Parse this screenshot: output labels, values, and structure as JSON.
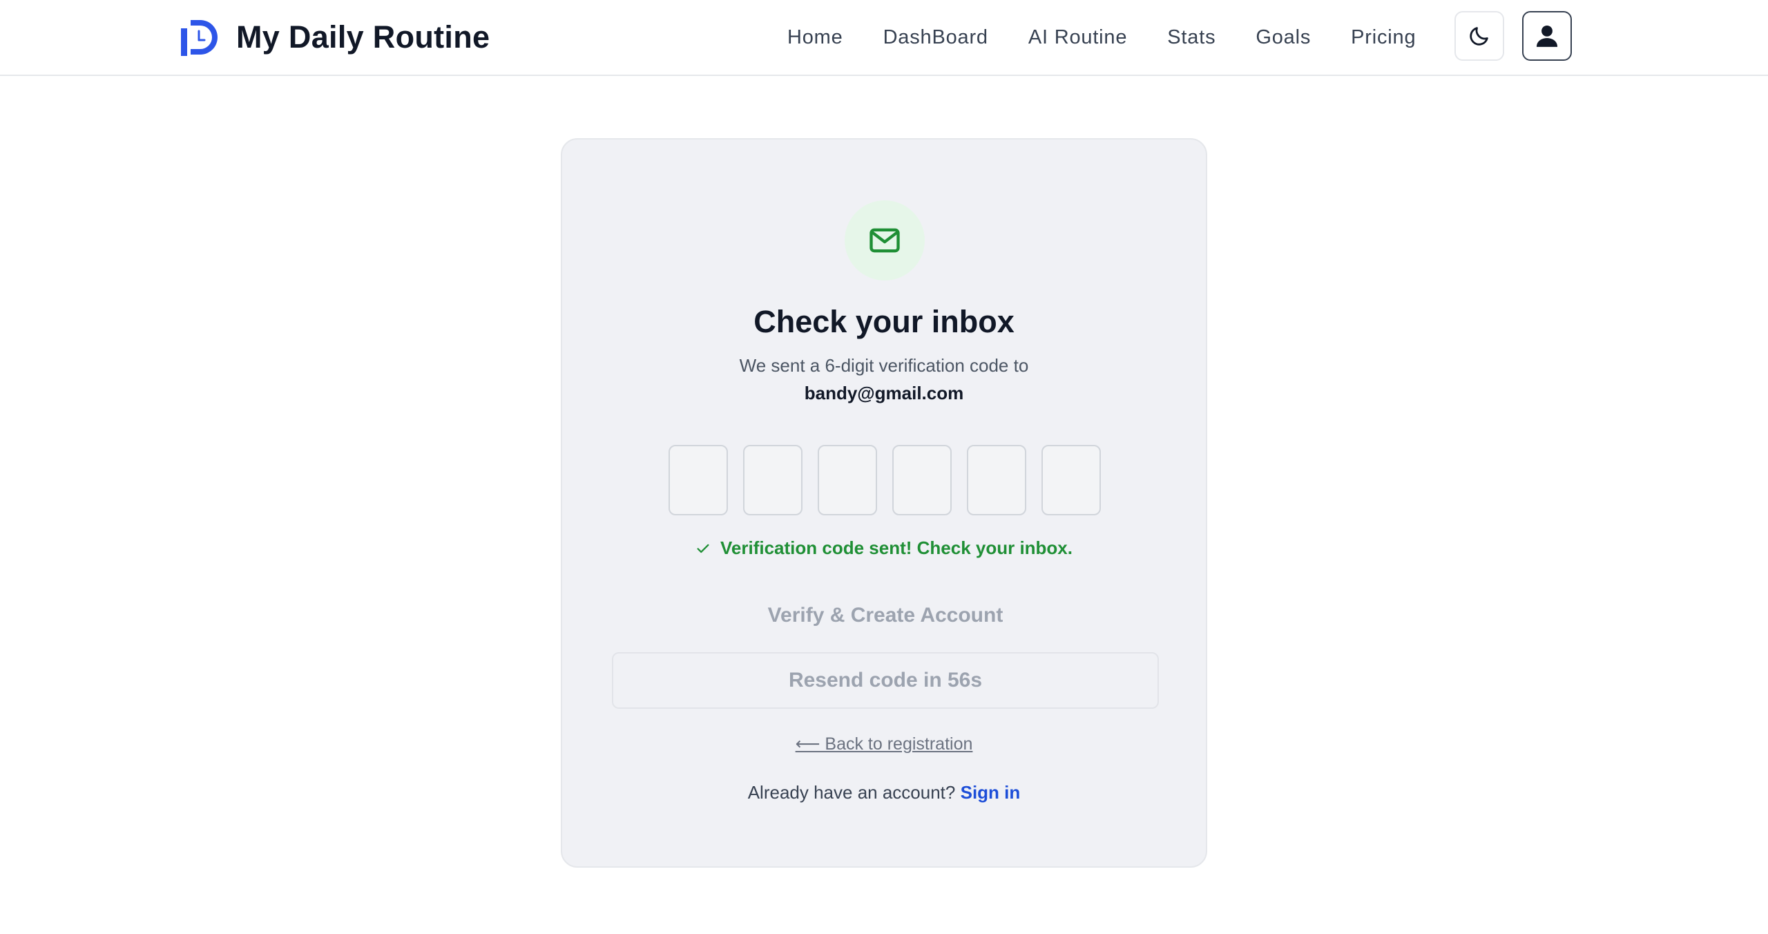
{
  "app": {
    "name": "My Daily Routine",
    "brand_color": "#2d55e8"
  },
  "nav": {
    "items": [
      {
        "label": "Home"
      },
      {
        "label": "DashBoard"
      },
      {
        "label": "AI Routine"
      },
      {
        "label": "Stats"
      },
      {
        "label": "Goals"
      },
      {
        "label": "Pricing"
      }
    ],
    "theme_toggle_icon": "moon-icon",
    "user_icon": "user-icon"
  },
  "verify": {
    "icon": "mail-icon",
    "title": "Check your inbox",
    "subtitle": "We sent a 6-digit verification code to",
    "email": "bandy@gmail.com",
    "code_digits": [
      "",
      "",
      "",
      "",
      "",
      ""
    ],
    "success_message": "Verification code sent! Check your inbox.",
    "success_color": "#1f8f35",
    "verify_button_label": "Verify & Create Account",
    "resend_button_label": "Resend code in 56s",
    "back_link_label": "⟵ Back to registration",
    "signin_prompt": "Already have an account?",
    "signin_link_label": "Sign in"
  }
}
